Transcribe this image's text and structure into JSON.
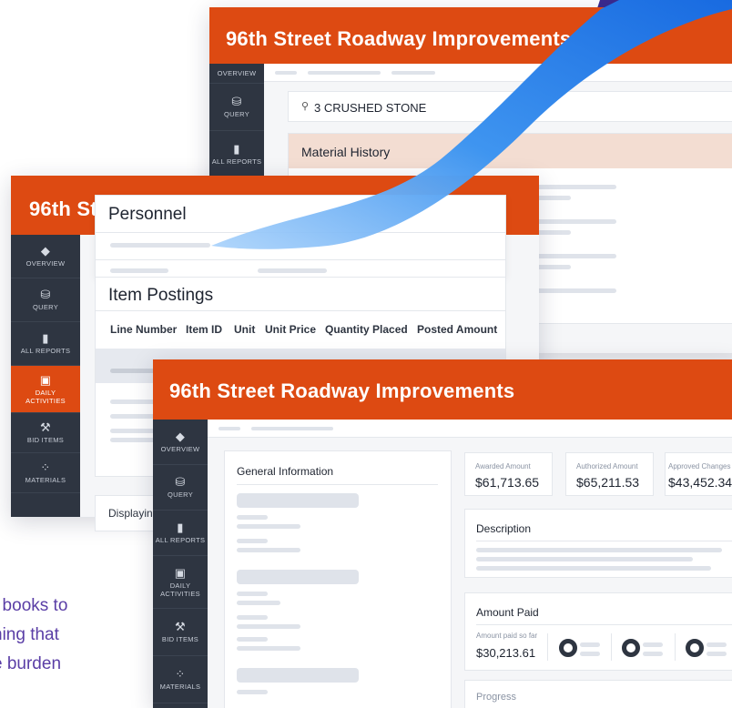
{
  "back_window": {
    "title": "96th Street Roadway Improvements",
    "sidebar": [
      {
        "icon": "layers-icon",
        "glyph": "",
        "label": "OVERVIEW"
      },
      {
        "icon": "database-icon",
        "glyph": "⛁",
        "label": "QUERY"
      },
      {
        "icon": "chart-icon",
        "glyph": "▮",
        "label": "ALL REPORTS"
      }
    ],
    "search_value": "3 CRUSHED STONE",
    "search_glyph": "⚲",
    "panel_title": "Material History"
  },
  "middle_window": {
    "title_partial": "96th St",
    "sidebar": [
      {
        "icon": "layers-icon",
        "glyph": "◆",
        "label": "OVERVIEW"
      },
      {
        "icon": "database-icon",
        "glyph": "⛁",
        "label": "QUERY"
      },
      {
        "icon": "chart-icon",
        "glyph": "▮",
        "label": "ALL REPORTS"
      },
      {
        "icon": "calendar-icon",
        "glyph": "▣",
        "label": "DAILY ACTIVITIES"
      },
      {
        "icon": "gavel-icon",
        "glyph": "⚒",
        "label": "BID ITEMS"
      },
      {
        "icon": "materials-icon",
        "glyph": "⁘",
        "label": "MATERIALS"
      }
    ],
    "personnel_title": "Personnel",
    "item_postings_title": "Item Postings",
    "columns": [
      "Line Number",
      "Item ID",
      "Unit",
      "Unit Price",
      "Quantity Placed",
      "Posted Amount"
    ],
    "displaying_text": "Displayin"
  },
  "front_window": {
    "title": "96th Street Roadway Improvements",
    "sidebar": [
      {
        "icon": "layers-icon",
        "glyph": "◆",
        "label": "OVERVIEW"
      },
      {
        "icon": "database-icon",
        "glyph": "⛁",
        "label": "QUERY"
      },
      {
        "icon": "chart-icon",
        "glyph": "▮",
        "label": "ALL REPORTS"
      },
      {
        "icon": "calendar-icon",
        "glyph": "▣",
        "label": "DAILY ACTIVITIES"
      },
      {
        "icon": "gavel-icon",
        "glyph": "⚒",
        "label": "BID ITEMS"
      },
      {
        "icon": "materials-icon",
        "glyph": "⁘",
        "label": "MATERIALS"
      }
    ],
    "general_info_title": "General Information",
    "stats": [
      {
        "label": "Awarded Amount",
        "value": "$61,713.65"
      },
      {
        "label": "Authorized Amount",
        "value": "$65,211.53"
      },
      {
        "label": "Approved Changes",
        "value": "$43,452.34"
      }
    ],
    "description_title": "Description",
    "amount_paid_title": "Amount Paid",
    "amount_paid_label": "Amount paid so far",
    "amount_paid_value": "$30,213.61",
    "progress_title": "Progress"
  },
  "footer_text": {
    "line1": "f books to",
    "line2": "hing that",
    "line3": "e burden"
  },
  "colors": {
    "accent": "#dd4a12",
    "sidebar": "#2e3541",
    "ribbon": "#1a7be8",
    "purple": "#3b2a8f"
  }
}
